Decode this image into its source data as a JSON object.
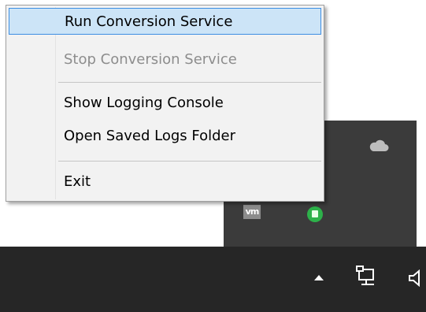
{
  "context_menu": {
    "items": [
      {
        "label": "Run Conversion Service",
        "state": "highlighted"
      },
      {
        "label": "Stop Conversion Service",
        "state": "disabled"
      },
      {
        "label": "Show Logging Console",
        "state": "enabled"
      },
      {
        "label": "Open Saved Logs Folder",
        "state": "enabled"
      },
      {
        "label": "Exit",
        "state": "enabled"
      }
    ]
  },
  "tray": {
    "vm_icon_text": "vm",
    "icons": [
      "vm-icon",
      "green-app-icon",
      "onedrive-icon"
    ]
  },
  "taskbar": {
    "icons": [
      "show-hidden-icons-chevron-icon",
      "network-icon",
      "volume-icon"
    ]
  },
  "colors": {
    "menu_highlight": "#cce4f7",
    "menu_highlight_border": "#3d8ee3",
    "disabled_text": "#8d8d8d",
    "taskbar": "#262626",
    "tray_flyout": "#3b3b3b"
  }
}
